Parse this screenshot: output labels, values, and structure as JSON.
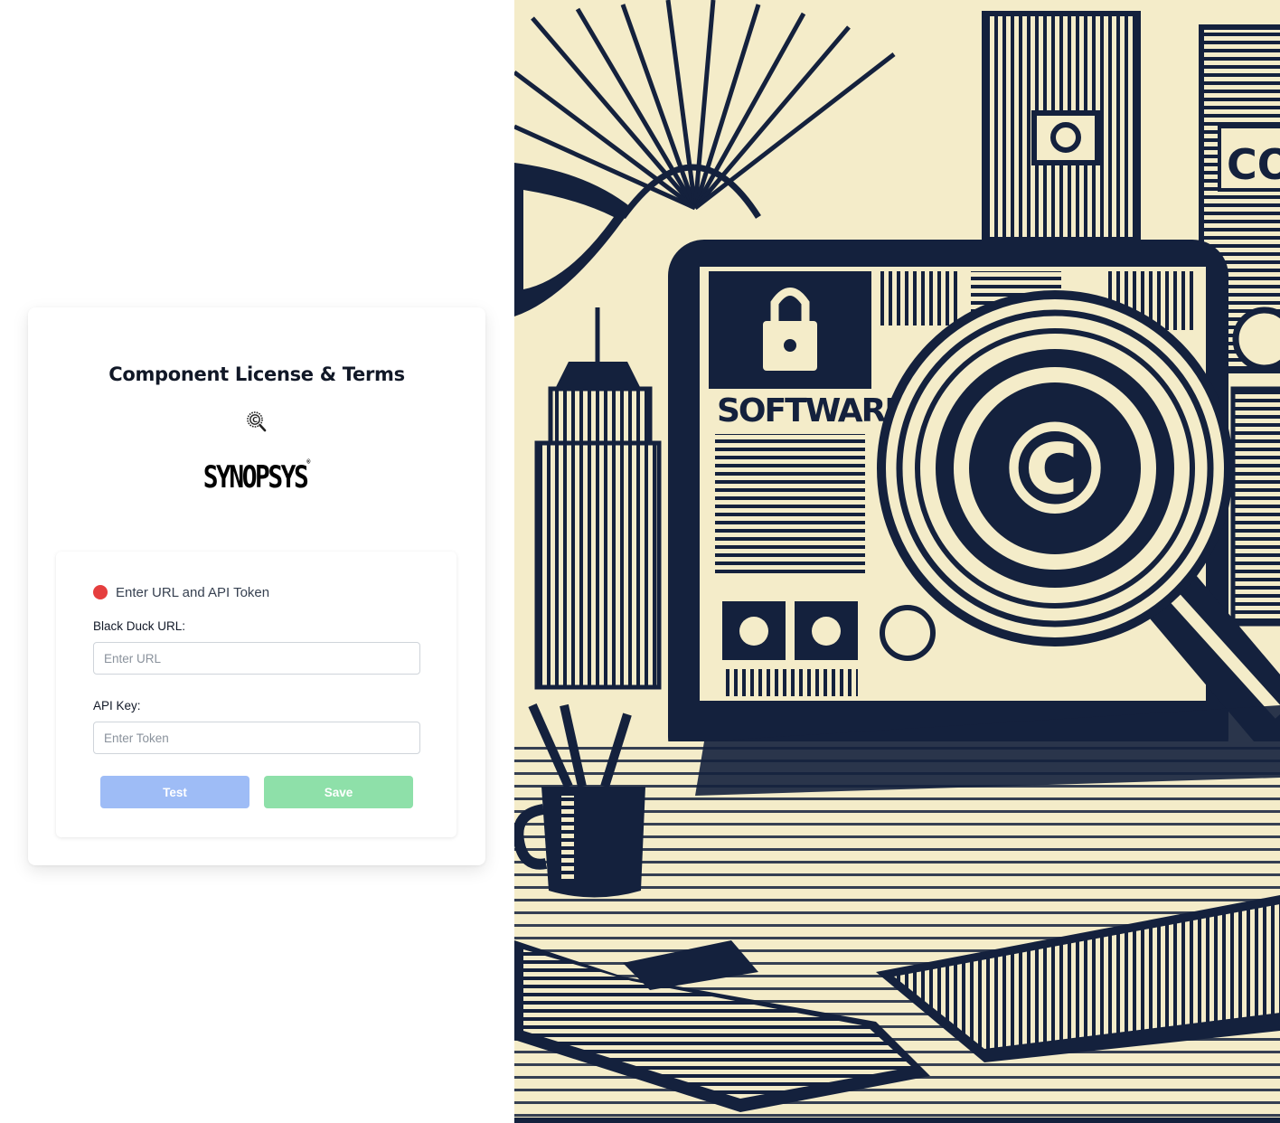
{
  "header": {
    "title": "Component License & Terms",
    "title_icon": "magnifier-copyright-icon"
  },
  "brand": {
    "logo_text": "SYNOPSYS",
    "logo_mark": "®"
  },
  "status": {
    "text": "Enter URL and API Token",
    "color": "#e53e3e"
  },
  "form": {
    "url_label": "Black Duck URL:",
    "url_value": "",
    "url_placeholder": "Enter URL",
    "token_label": "API Key:",
    "token_value": "",
    "token_placeholder": "Enter Token"
  },
  "buttons": {
    "test_label": "Test",
    "save_label": "Save"
  },
  "illustration": {
    "screen_text": "SOFTWARE",
    "side_text": "CO",
    "symbol": "©"
  },
  "colors": {
    "test_button": "#9ebcf6",
    "save_button": "#8ee0a9",
    "illustration_ink": "#14213d",
    "illustration_paper": "#f4ecc9"
  }
}
